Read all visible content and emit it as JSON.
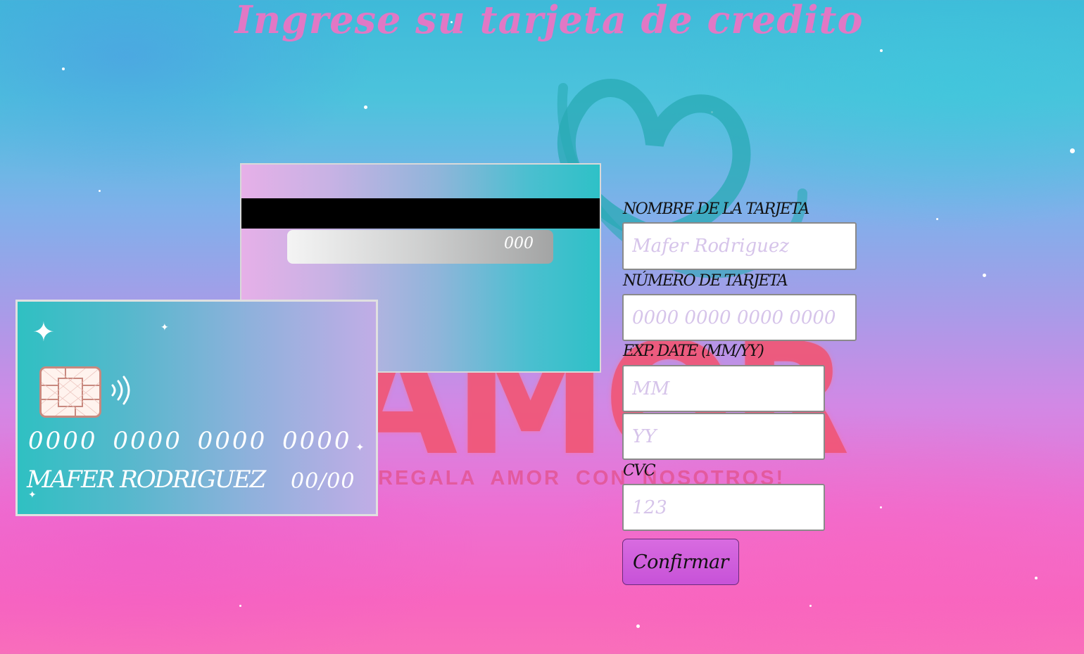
{
  "page": {
    "title": "Ingrese su tarjeta de credito"
  },
  "logo": {
    "word": "AMOR",
    "tagline": "REGALA AMOR CON NOSOTROS!"
  },
  "card_front": {
    "number": "0000 0000 0000 0000",
    "holder": "MAFER RODRIGUEZ",
    "expiry": "00/00"
  },
  "card_back": {
    "cvc": "000"
  },
  "form": {
    "name_label": "NOMBRE DE LA TARJETA",
    "name_placeholder": "Mafer Rodriguez",
    "number_label": "NÚMERO DE TARJETA",
    "number_placeholder": "0000 0000 0000 0000",
    "exp_label": "EXP. DATE (MM/YY)",
    "month_placeholder": "MM",
    "year_placeholder": "YY",
    "cvc_label": "CVC",
    "cvc_placeholder": "123",
    "confirm_label": "Confirmar"
  },
  "colors": {
    "title": "#e178c5",
    "button": "#d86be0",
    "card_teal": "#2fc0c2",
    "card_lilac": "#c1ade6"
  }
}
